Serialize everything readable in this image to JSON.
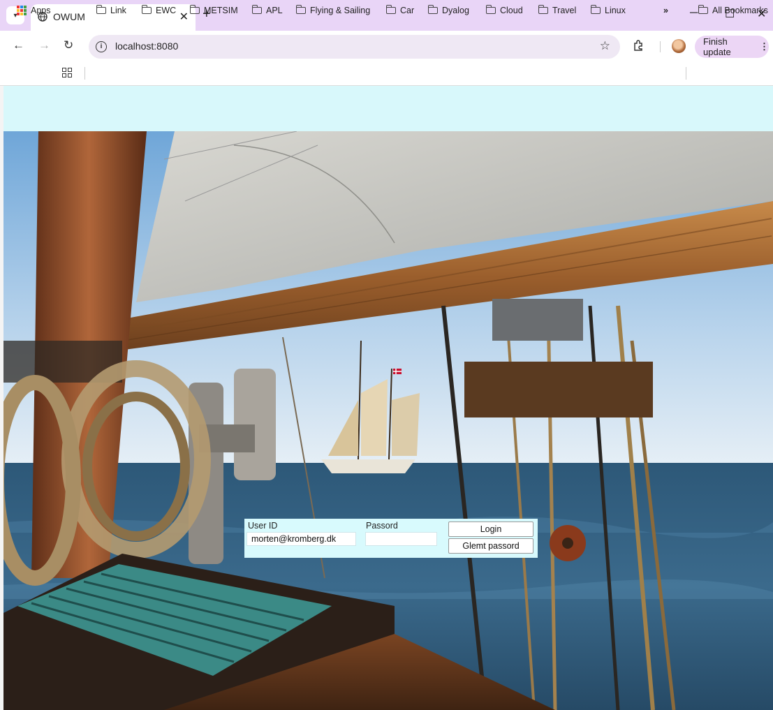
{
  "browser": {
    "tab_title": "OWUM",
    "url": "localhost:8080",
    "finish_update_label": "Finish update",
    "bookmarks": [
      "Apps",
      "Link",
      "EWC",
      "METSIM",
      "APL",
      "Flying & Sailing",
      "Car",
      "Dyalog",
      "Cloud",
      "Travel",
      "Linux"
    ],
    "overflow_label": "»",
    "all_bookmarks_label": "All Bookmarks"
  },
  "login": {
    "user_id_label": "User ID",
    "user_id_value": "morten@kromberg.dk",
    "password_label": "Passord",
    "password_value": "",
    "login_button": "Login",
    "forgot_button": "Glemt passord"
  },
  "colors": {
    "titlebar": "#e9d5f7",
    "page_background": "#d8f8fb",
    "login_panel": "#d8fafd"
  }
}
